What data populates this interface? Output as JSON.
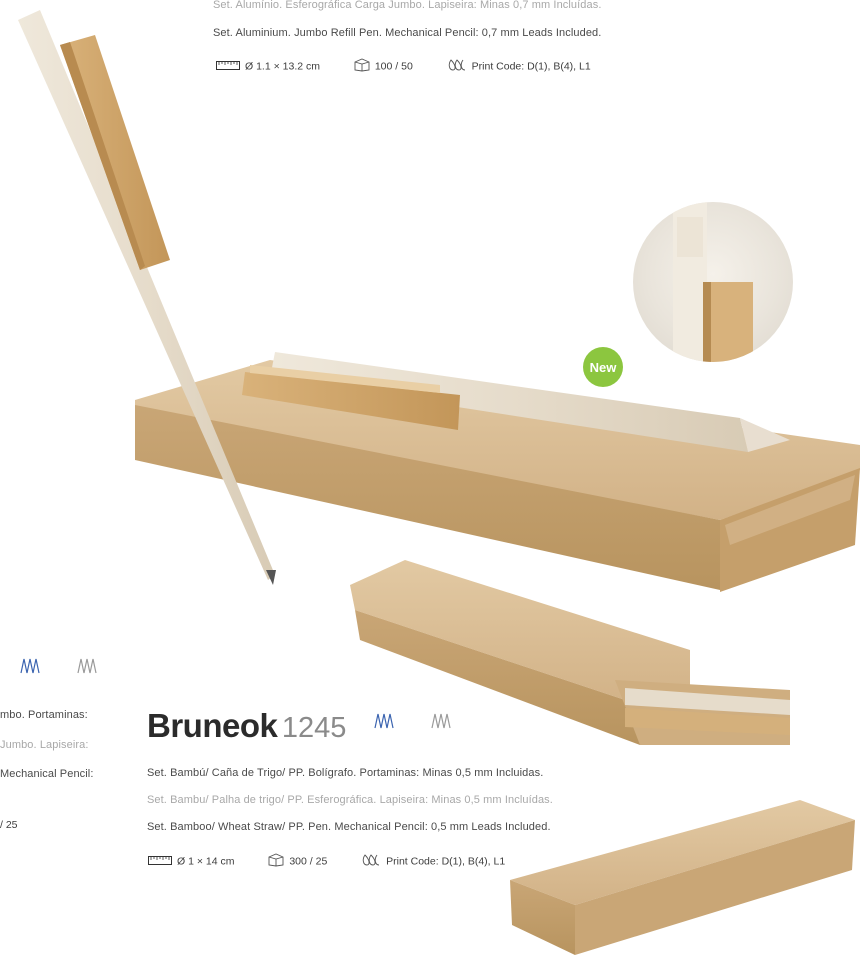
{
  "top_product": {
    "line_pt": "Set. Alumínio. Esferográfica Carga Jumbo. Lapiseira: Minas 0,7 mm Incluídas.",
    "line_en": "Set. Aluminium. Jumbo Refill Pen. Mechanical Pencil: 0,7 mm Leads Included.",
    "specs": {
      "size": "Ø 1.1 × 13.2 cm",
      "packing": "100 / 50",
      "print": "Print Code: D(1), B(4), L1"
    }
  },
  "badge": {
    "new_label": "New"
  },
  "left_partial": {
    "line1": "mbo. Portaminas:",
    "line2": "Jumbo. Lapiseira:",
    "line3": "Mechanical Pencil:",
    "line4": "/ 25"
  },
  "bruneok": {
    "name": "Bruneok",
    "code": "1245",
    "line_es": "Set. Bambú/ Caña de Trigo/ PP. Bolígrafo. Portaminas: Minas 0,5 mm Incluidas.",
    "line_pt": "Set. Bambu/ Palha de trigo/ PP. Esferográfica. Lapiseira: Minas 0,5 mm Incluídas.",
    "line_en": "Set. Bamboo/ Wheat Straw/ PP. Pen. Mechanical Pencil: 0,5 mm Leads Included.",
    "specs": {
      "size": "Ø 1 × 14 cm",
      "packing": "300 / 25",
      "print": "Print Code: D(1), B(4), L1"
    }
  },
  "colors": {
    "new_badge": "#8cc63f",
    "ink_blue": "#3b64b0",
    "ink_gray": "#9a9a9a",
    "kraft": "#d6b88f"
  },
  "icons": [
    "ruler-icon",
    "box-icon",
    "print-drops-icon",
    "blue-ink-scribble-icon",
    "gray-ink-scribble-icon"
  ]
}
